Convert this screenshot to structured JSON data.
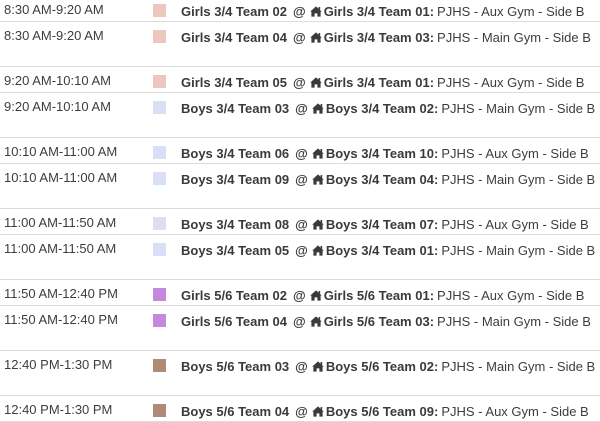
{
  "games": [
    {
      "time": "8:30 AM-9:20 AM",
      "color": "#ecc7bd",
      "away": "Girls 3/4 Team 02",
      "at": "@",
      "home": "Girls 3/4 Team 01",
      "location": "PJHS - Aux Gym - Side B"
    },
    {
      "time": "8:30 AM-9:20 AM",
      "color": "#ecc7bd",
      "away": "Girls 3/4 Team 04",
      "at": "@",
      "home": "Girls 3/4 Team 03",
      "location": "PJHS - Main Gym - Side B"
    },
    {
      "time": "9:20 AM-10:10 AM",
      "color": "#ecc7bd",
      "away": "Girls 3/4 Team 05",
      "at": "@",
      "home": "Girls 3/4 Team 01",
      "location": "PJHS - Aux Gym - Side B"
    },
    {
      "time": "9:20 AM-10:10 AM",
      "color": "#dadff6",
      "away": "Boys 3/4 Team 03",
      "at": "@",
      "home": "Boys 3/4 Team 02",
      "location": "PJHS - Main Gym - Side B"
    },
    {
      "time": "10:10 AM-11:00 AM",
      "color": "#dadff6",
      "away": "Boys 3/4 Team 06",
      "at": "@",
      "home": "Boys 3/4 Team 10",
      "location": "PJHS - Aux Gym - Side B"
    },
    {
      "time": "10:10 AM-11:00 AM",
      "color": "#dadff6",
      "away": "Boys 3/4 Team 09",
      "at": "@",
      "home": "Boys 3/4 Team 04",
      "location": "PJHS - Main Gym - Side B"
    },
    {
      "time": "11:00 AM-11:50 AM",
      "color": "#dadff6",
      "away": "Boys 3/4 Team 08",
      "at": "@",
      "home": "Boys 3/4 Team 07",
      "location": "PJHS - Aux Gym - Side B"
    },
    {
      "time": "11:00 AM-11:50 AM",
      "color": "#dadff6",
      "away": "Boys 3/4 Team 05",
      "at": "@",
      "home": "Boys 3/4 Team 01",
      "location": "PJHS - Main Gym - Side B"
    },
    {
      "time": "11:50 AM-12:40 PM",
      "color": "#c688dd",
      "away": "Girls 5/6 Team 02",
      "at": "@",
      "home": "Girls 5/6 Team 01",
      "location": "PJHS - Aux Gym - Side B"
    },
    {
      "time": "11:50 AM-12:40 PM",
      "color": "#c688dd",
      "away": "Girls 5/6 Team 04",
      "at": "@",
      "home": "Girls 5/6 Team 03",
      "location": "PJHS - Main Gym - Side B"
    },
    {
      "time": "12:40 PM-1:30 PM",
      "color": "#b18a75",
      "away": "Boys 5/6 Team 03",
      "at": "@",
      "home": "Boys 5/6 Team 02",
      "location": "PJHS - Main Gym - Side B"
    },
    {
      "time": "12:40 PM-1:30 PM",
      "color": "#b18a75",
      "away": "Boys 5/6 Team 04",
      "at": "@",
      "home": "Boys 5/6 Team 09",
      "location": "PJHS - Aux Gym - Side B"
    }
  ],
  "icons": {
    "home": "home-icon"
  }
}
